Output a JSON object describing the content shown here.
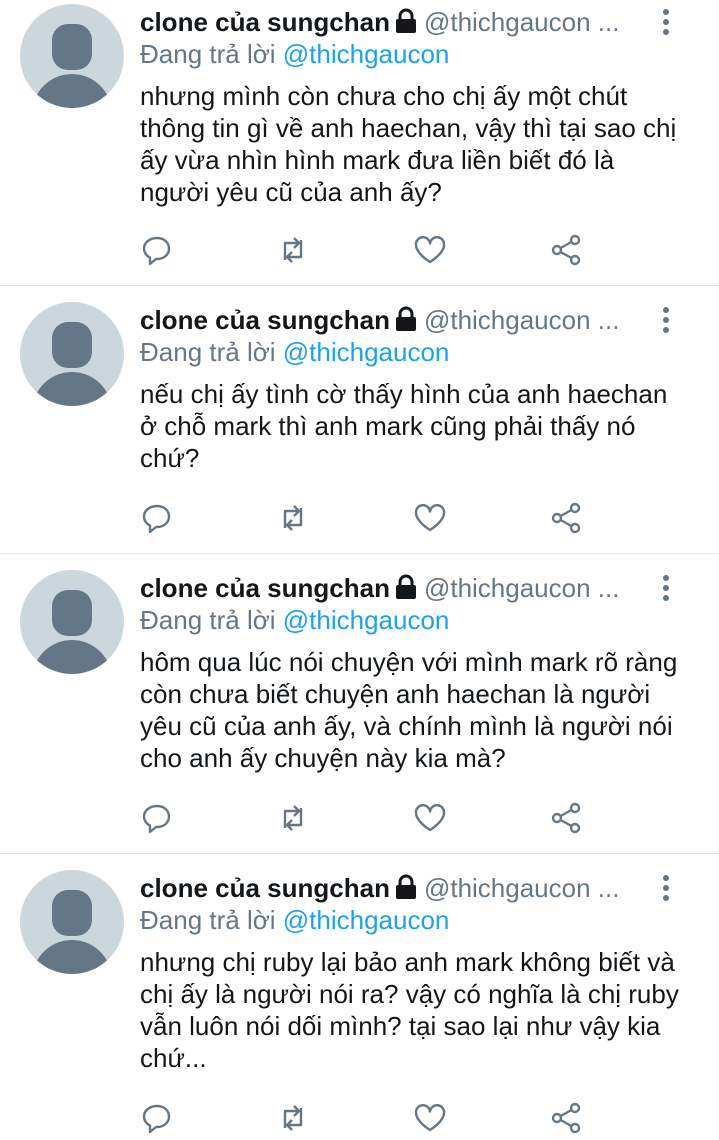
{
  "tweets": [
    {
      "name": "clone của sungchan",
      "handle": "@thichgaucon ...",
      "reply_prefix": "Đang trả lời ",
      "reply_to": "@thichgaucon",
      "text": "nhưng mình còn chưa cho chị ấy một chút thông tin gì về anh haechan, vậy thì tại sao chị ấy vừa nhìn hình mark đưa liền biết đó là người yêu cũ của anh ấy?"
    },
    {
      "name": "clone của sungchan",
      "handle": "@thichgaucon ...",
      "reply_prefix": "Đang trả lời ",
      "reply_to": "@thichgaucon",
      "text": "nếu chị ấy tình cờ thấy hình của anh haechan ở chỗ mark thì anh mark cũng phải thấy nó chứ?"
    },
    {
      "name": "clone của sungchan",
      "handle": "@thichgaucon ...",
      "reply_prefix": "Đang trả lời ",
      "reply_to": "@thichgaucon",
      "text": "hôm qua lúc nói chuyện với mình mark rõ ràng còn chưa biết chuyện anh haechan là người yêu cũ của anh ấy, và chính mình là người nói cho anh ấy chuyện này kia mà?"
    },
    {
      "name": "clone của sungchan",
      "handle": "@thichgaucon ...",
      "reply_prefix": "Đang trả lời ",
      "reply_to": "@thichgaucon",
      "text": "nhưng chị ruby lại bảo anh mark không biết và chị ấy là người nói ra? vậy có nghĩa là chị ruby vẫn luôn nói dối mình? tại sao lại như vậy kia chứ..."
    }
  ],
  "icons": {
    "avatar": "default-avatar",
    "lock": "lock-icon",
    "more": "more-vertical-icon",
    "reply": "reply-icon",
    "retweet": "retweet-icon",
    "like": "heart-icon",
    "share": "share-icon"
  },
  "colors": {
    "text": "#14171a",
    "secondary": "#657786",
    "link": "#1da1f2",
    "divider": "#e1e8ed",
    "avatar_bg": "#ccd6dd"
  }
}
